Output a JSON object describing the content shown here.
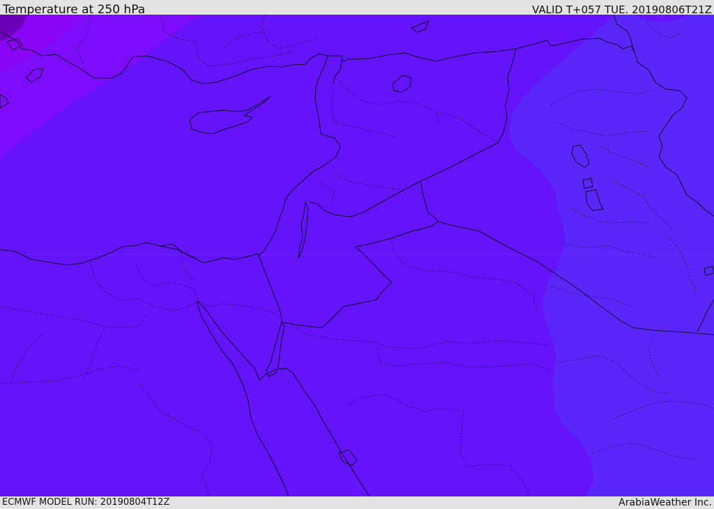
{
  "header": {
    "title": "Temperature at 250 hPa",
    "valid": "VALID T+057 TUE. 20190806T21Z"
  },
  "footer": {
    "model_run": "ECMWF MODEL RUN: 20190804T12Z",
    "provider": "ArabiaWeather Inc."
  },
  "colors": {
    "field_main": "#6413fa",
    "field_west": "#7c0cfb",
    "field_nw": "#8a05f5",
    "field_corner": "#6a00b8",
    "field_east": "#5a26fa",
    "borders": "#0d0d26",
    "frame": "#e4e4e4"
  }
}
